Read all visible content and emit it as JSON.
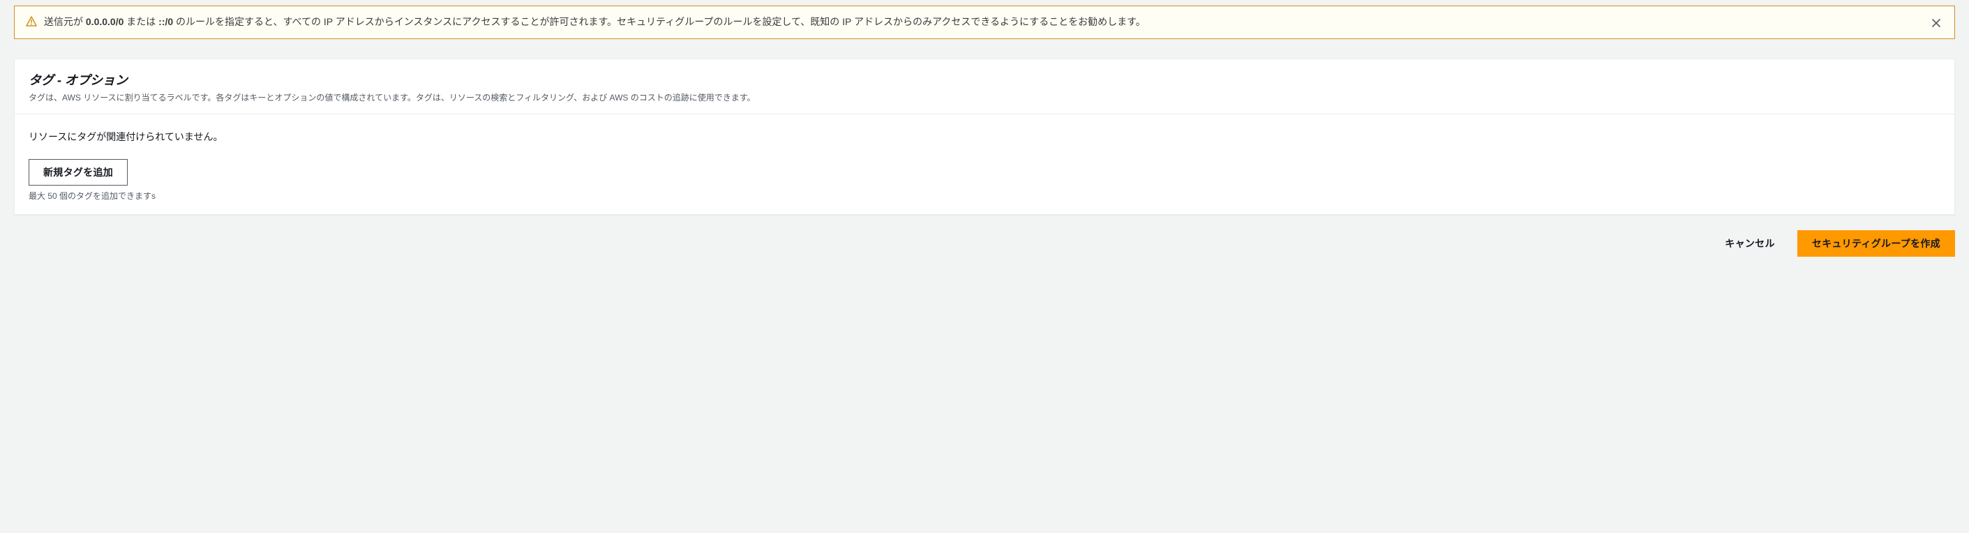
{
  "alert": {
    "message_prefix": "送信元が ",
    "message_bold": "0.0.0.0/0",
    "message_mid": " または ",
    "message_bold2": "::/0",
    "message_suffix": " のルールを指定すると、すべての IP アドレスからインスタンスにアクセスすることが許可されます。セキュリティグループのルールを設定して、既知の IP アドレスからのみアクセスできるようにすることをお勧めします。"
  },
  "tags_panel": {
    "title": "タグ - オプション",
    "description": "タグは、AWS リソースに割り当てるラベルです。各タグはキーとオプションの値で構成されています。タグは、リソースの検索とフィルタリング、および AWS のコストの追跡に使用できます。",
    "empty_message": "リソースにタグが関連付けられていません。",
    "add_button": "新規タグを追加",
    "limit_hint": "最大 50 個のタグを追加できますs"
  },
  "footer": {
    "cancel": "キャンセル",
    "create": "セキュリティグループを作成"
  }
}
